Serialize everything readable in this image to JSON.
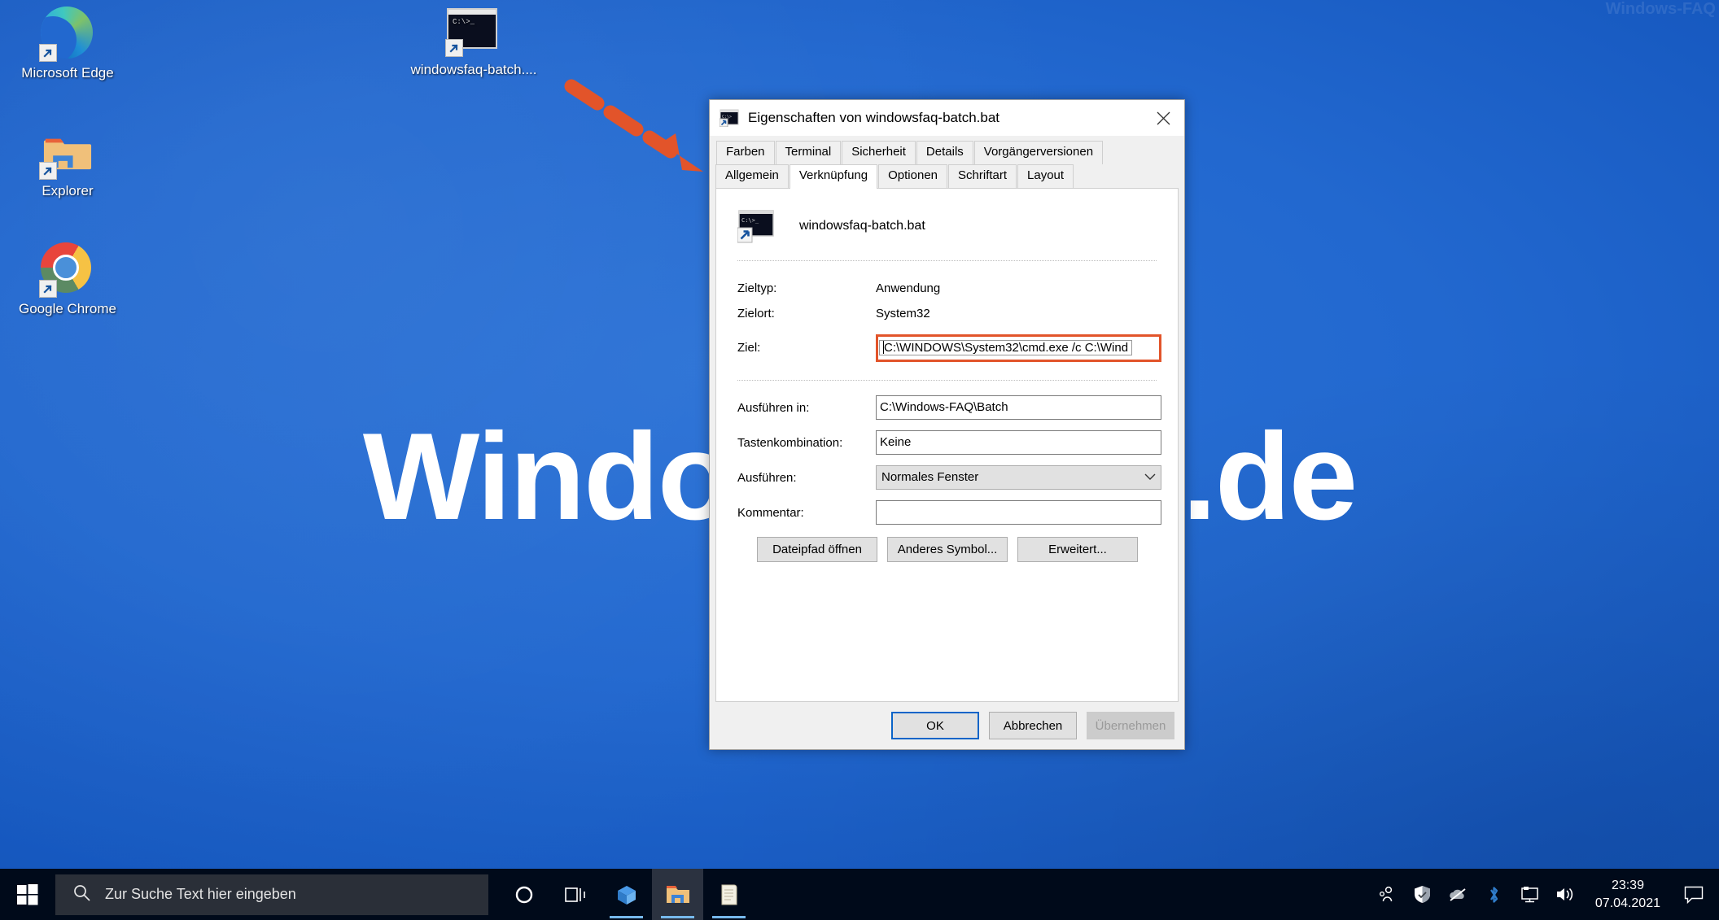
{
  "desktop": {
    "watermark_text": "Windows-FAQ.de",
    "watermark_corner": "Windows-FAQ",
    "icons": [
      {
        "label": "Microsoft Edge",
        "icon": "edge-icon"
      },
      {
        "label": "Explorer",
        "icon": "folder-icon"
      },
      {
        "label": "Google Chrome",
        "icon": "chrome-icon"
      },
      {
        "label": "windowsfaq-batch....",
        "icon": "batch-file-icon"
      }
    ],
    "annotation": {
      "type": "dashed-arrow",
      "color": "#e2542a"
    }
  },
  "dialog": {
    "title": "Eigenschaften von windowsfaq-batch.bat",
    "close_label": "✕",
    "tabs_row1": [
      "Farben",
      "Terminal",
      "Sicherheit",
      "Details",
      "Vorgängerversionen"
    ],
    "tabs_row2": [
      "Allgemein",
      "Verknüpfung",
      "Optionen",
      "Schriftart",
      "Layout"
    ],
    "active_tab": "Verknüpfung",
    "file_name": "windowsfaq-batch.bat",
    "fields": [
      {
        "label": "Zieltyp:",
        "value": "Anwendung",
        "kind": "static"
      },
      {
        "label": "Zielort:",
        "value": "System32",
        "kind": "static"
      },
      {
        "label": "Ziel:",
        "value": "C:\\WINDOWS\\System32\\cmd.exe /c C:\\Wind",
        "kind": "textbox-highlighted"
      },
      {
        "label": "Ausführen in:",
        "value": "C:\\Windows-FAQ\\Batch",
        "kind": "textbox"
      },
      {
        "label": "Tastenkombination:",
        "value": "Keine",
        "kind": "textbox"
      },
      {
        "label": "Ausführen:",
        "value": "Normales Fenster",
        "kind": "combobox"
      },
      {
        "label": "Kommentar:",
        "value": "",
        "kind": "textbox"
      }
    ],
    "action_buttons": [
      "Dateipfad öffnen",
      "Anderes Symbol...",
      "Erweitert..."
    ],
    "footer_buttons": [
      {
        "label": "OK",
        "state": "default"
      },
      {
        "label": "Abbrechen",
        "state": "normal"
      },
      {
        "label": "Übernehmen",
        "state": "disabled"
      }
    ],
    "highlight_color": "#e2542a"
  },
  "taskbar": {
    "start_label": "start-icon",
    "search_placeholder": "Zur Suche Text hier eingeben",
    "items": [
      {
        "name": "cortana-icon",
        "running": false,
        "active": false
      },
      {
        "name": "task-view-icon",
        "running": false,
        "active": false
      },
      {
        "name": "store-icon",
        "running": true,
        "active": false
      },
      {
        "name": "file-explorer-icon",
        "running": true,
        "active": true
      },
      {
        "name": "notepad-icon",
        "running": true,
        "active": false
      }
    ],
    "tray": [
      "people-icon",
      "security-shield-icon",
      "onedrive-offline-icon",
      "bluetooth-icon",
      "network-icon",
      "volume-icon"
    ],
    "clock_time": "23:39",
    "clock_date": "07.04.2021",
    "action_center": "notification-icon"
  }
}
